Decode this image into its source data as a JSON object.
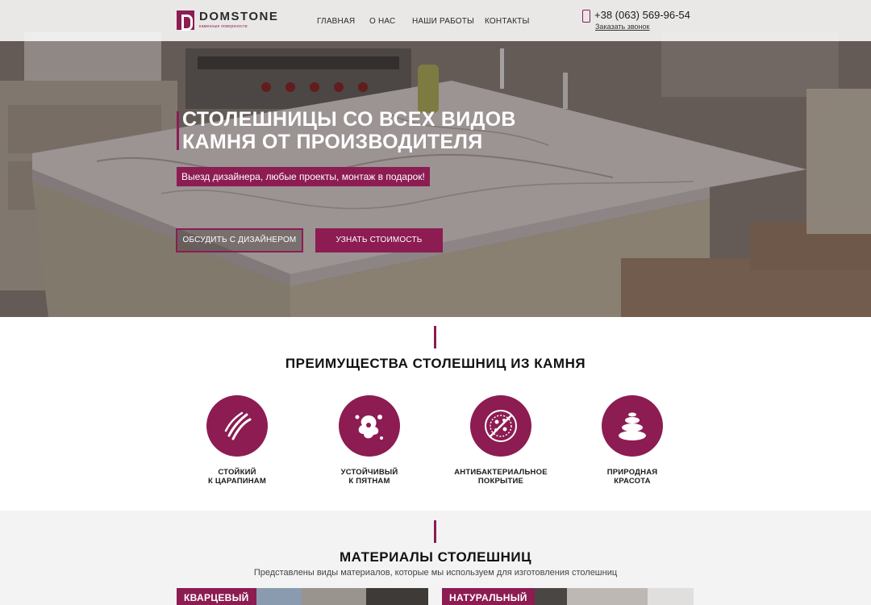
{
  "brand": {
    "name": "DOMSTONE",
    "tagline": "каменные поверхности"
  },
  "nav": [
    "ГЛАВНАЯ",
    "О НАС",
    "НАШИ РАБОТЫ",
    "КОНТАКТЫ"
  ],
  "contact": {
    "phone": "+38 (063) 569-96-54",
    "callback": "Заказать звонок"
  },
  "hero": {
    "title_line1": "СТОЛЕШНИЦЫ СО ВСЕХ ВИДОВ",
    "title_line2": "КАМНЯ ОТ ПРОИЗВОДИТЕЛЯ",
    "subtitle": "Выезд дизайнера, любые проекты, монтаж в подарок!",
    "btn_discuss": "ОБСУДИТЬ С ДИЗАЙНЕРОМ",
    "btn_price": "УЗНАТЬ СТОИМОСТЬ"
  },
  "advantages": {
    "title": "ПРЕИМУЩЕСТВА СТОЛЕШНИЦ ИЗ КАМНЯ",
    "items": [
      {
        "line1": "СТОЙКИЙ",
        "line2": "К ЦАРАПИНАМ",
        "icon": "scratch-icon"
      },
      {
        "line1": "УСТОЙЧИВЫЙ",
        "line2": "К ПЯТНАМ",
        "icon": "stain-splash-icon"
      },
      {
        "line1": "АНТИБАКТЕРИАЛЬНОЕ",
        "line2": "ПОКРЫТИЕ",
        "icon": "no-bacteria-icon"
      },
      {
        "line1": "ПРИРОДНАЯ",
        "line2": "КРАСОТА",
        "icon": "stacked-stones-icon"
      }
    ]
  },
  "materials": {
    "title": "МАТЕРИАЛЫ СТОЛЕШНИЦ",
    "subtitle": "Представлены виды материалов, которые мы используем для изготовления столешниц",
    "cards": [
      "КВАРЦЕВЫЙ",
      "НАТУРАЛЬНЫЙ"
    ]
  },
  "colors": {
    "accent": "#8c1c52",
    "header_bg": "#ffffff",
    "section_bg": "#f3f3f3"
  }
}
